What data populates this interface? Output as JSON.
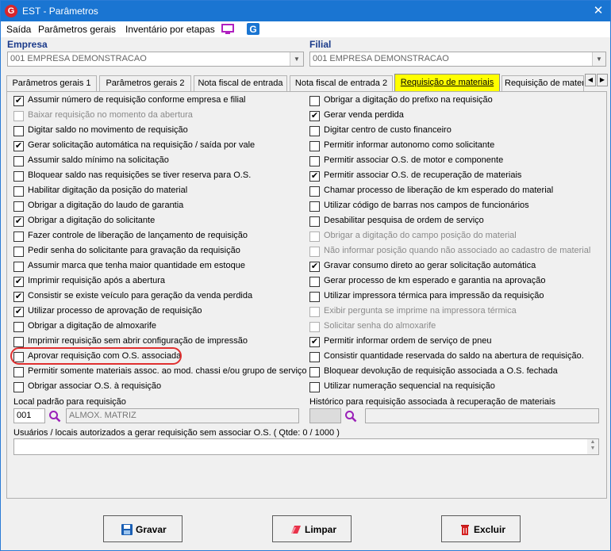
{
  "window": {
    "title": "EST - Parâmetros",
    "close": "✕"
  },
  "menu": {
    "items": [
      "Saída",
      "Parâmetros gerais",
      "Inventário por etapas"
    ]
  },
  "empresa": {
    "label": "Empresa",
    "value": "001 EMPRESA DEMONSTRACAO"
  },
  "filial": {
    "label": "Filial",
    "value": "001 EMPRESA DEMONSTRACAO"
  },
  "tabs": [
    {
      "label": "Parâmetros gerais 1"
    },
    {
      "label": "Parâmetros gerais 2"
    },
    {
      "label": "Nota fiscal de entrada"
    },
    {
      "label": "Nota fiscal de entrada 2"
    },
    {
      "label": "Requisição de materiais",
      "active": true
    },
    {
      "label": "Requisição de materi"
    }
  ],
  "left_options": [
    {
      "label": "Assumir número de requisição conforme empresa e filial",
      "checked": true,
      "disabled": false
    },
    {
      "label": "Baixar requisição no momento da abertura",
      "checked": false,
      "disabled": true
    },
    {
      "label": "Digitar saldo no movimento de requisição",
      "checked": false,
      "disabled": false
    },
    {
      "label": "Gerar solicitação automática na requisição / saída por vale",
      "checked": true,
      "disabled": false
    },
    {
      "label": "Assumir saldo mínimo na solicitação",
      "checked": false,
      "disabled": false
    },
    {
      "label": "Bloquear saldo nas requisições se tiver reserva para O.S.",
      "checked": false,
      "disabled": false
    },
    {
      "label": "Habilitar digitação da posição do material",
      "checked": false,
      "disabled": false
    },
    {
      "label": "Obrigar a digitação do laudo de garantia",
      "checked": false,
      "disabled": false
    },
    {
      "label": "Obrigar a digitação do solicitante",
      "checked": true,
      "disabled": false
    },
    {
      "label": "Fazer controle de liberação de lançamento de requisição",
      "checked": false,
      "disabled": false
    },
    {
      "label": "Pedir senha do solicitante para gravação da requisição",
      "checked": false,
      "disabled": false
    },
    {
      "label": "Assumir marca que tenha maior quantidade em estoque",
      "checked": false,
      "disabled": false
    },
    {
      "label": "Imprimir requisição após a abertura",
      "checked": true,
      "disabled": false
    },
    {
      "label": "Consistir se existe veículo para geração da venda perdida",
      "checked": true,
      "disabled": false
    },
    {
      "label": "Utilizar processo de aprovação de requisição",
      "checked": true,
      "disabled": false
    },
    {
      "label": "Obrigar a digitação de almoxarife",
      "checked": false,
      "disabled": false
    },
    {
      "label": "Imprimir requisição sem abrir configuração de impressão",
      "checked": false,
      "disabled": false
    },
    {
      "label": "Aprovar requisição com O.S. associada",
      "checked": false,
      "disabled": false
    },
    {
      "label": "Permitir somente materiais assoc. ao mod. chassi e/ou grupo de serviço",
      "checked": false,
      "disabled": false
    },
    {
      "label": "Obrigar associar O.S. à requisição",
      "checked": false,
      "disabled": false
    }
  ],
  "right_options": [
    {
      "label": "Obrigar a digitação do prefixo na requisição",
      "checked": false,
      "disabled": false
    },
    {
      "label": "Gerar venda perdida",
      "checked": true,
      "disabled": false
    },
    {
      "label": "Digitar centro de custo financeiro",
      "checked": false,
      "disabled": false
    },
    {
      "label": "Permitir informar autonomo como solicitante",
      "checked": false,
      "disabled": false
    },
    {
      "label": "Permitir associar O.S. de motor e componente",
      "checked": false,
      "disabled": false
    },
    {
      "label": "Permitir associar O.S. de recuperação de materiais",
      "checked": true,
      "disabled": false
    },
    {
      "label": "Chamar processo de liberação de km esperado do material",
      "checked": false,
      "disabled": false
    },
    {
      "label": "Utilizar código de barras nos campos de funcionários",
      "checked": false,
      "disabled": false
    },
    {
      "label": "Desabilitar pesquisa de ordem de serviço",
      "checked": false,
      "disabled": false
    },
    {
      "label": "Obrigar a digitação do campo posição do material",
      "checked": false,
      "disabled": true
    },
    {
      "label": "Não informar posição quando não associado ao cadastro de material",
      "checked": false,
      "disabled": true
    },
    {
      "label": "Gravar consumo direto ao gerar solicitação automática",
      "checked": true,
      "disabled": false
    },
    {
      "label": "Gerar processo de km esperado e garantia na aprovação",
      "checked": false,
      "disabled": false
    },
    {
      "label": "Utilizar impressora térmica para impressão da requisição",
      "checked": false,
      "disabled": false
    },
    {
      "label": "Exibir pergunta se imprime na impressora térmica",
      "checked": false,
      "disabled": true
    },
    {
      "label": "Solicitar senha do almoxarife",
      "checked": false,
      "disabled": true
    },
    {
      "label": "Permitir informar ordem de serviço de pneu",
      "checked": true,
      "disabled": false
    },
    {
      "label": "Consistir quantidade reservada do saldo na abertura de requisição.",
      "checked": false,
      "disabled": false
    },
    {
      "label": "Bloquear devolução de requisição associada a O.S. fechada",
      "checked": false,
      "disabled": false
    },
    {
      "label": "Utilizar numeração sequencial na requisição",
      "checked": false,
      "disabled": false
    }
  ],
  "local": {
    "label": "Local padrão para requisição",
    "code": "001",
    "name": "ALMOX. MATRIZ"
  },
  "historico": {
    "label": "Histórico para requisição associada à recuperação de materiais",
    "code": "",
    "name": ""
  },
  "usuarios": {
    "label": "Usuários / locais autorizados a gerar requisição sem associar O.S.   ( Qtde: 0 / 1000 )"
  },
  "buttons": {
    "save": "Gravar",
    "clear": "Limpar",
    "delete": "Excluir"
  }
}
